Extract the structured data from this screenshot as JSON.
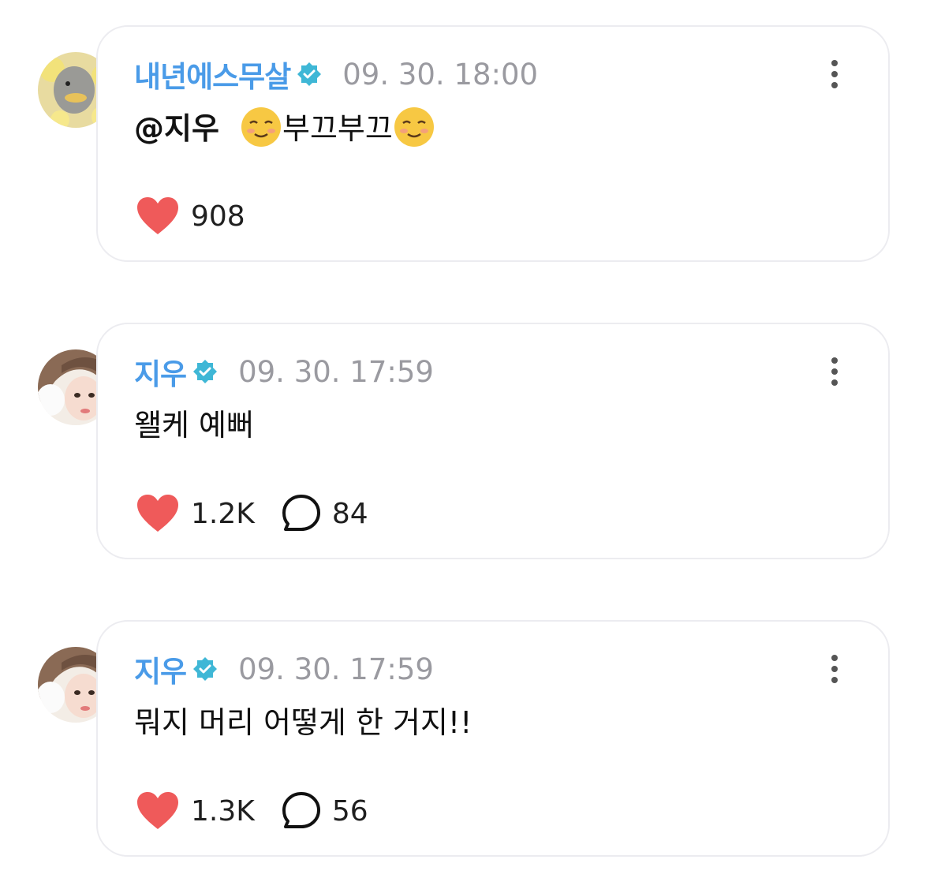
{
  "comments": [
    {
      "author": "내년에스무살",
      "verified": true,
      "timestamp": "09. 30. 18:00",
      "mention": "@지우",
      "text": "부끄부끄",
      "likes": "908",
      "replies": null,
      "avatar": "duck-avatar"
    },
    {
      "author": "지우",
      "verified": true,
      "timestamp": "09. 30. 17:59",
      "text": "왤케 예뻐",
      "likes": "1.2K",
      "replies": "84",
      "avatar": "user-photo-avatar"
    },
    {
      "author": "지우",
      "verified": true,
      "timestamp": "09. 30. 17:59",
      "text": "뭐지 머리 어떻게 한 거지!!",
      "likes": "1.3K",
      "replies": "56",
      "avatar": "user-photo-avatar"
    }
  ],
  "colors": {
    "author_name": "#4a9be8",
    "verified_badge": "#3fb7d6",
    "timestamp": "#9a9aa0",
    "heart": "#ef5a5a",
    "card_border": "#ececf0"
  },
  "icons": {
    "like": "heart-icon",
    "reply": "speech-bubble-icon",
    "more": "vertical-dots-icon",
    "verified": "verified-badge-icon",
    "emoji": "smiling-face-emoji"
  }
}
